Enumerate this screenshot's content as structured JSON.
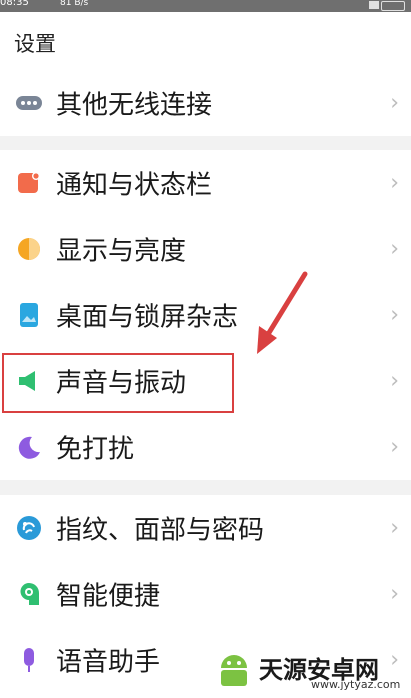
{
  "status_bar": {
    "time": "08:35",
    "speed": "81 B/s"
  },
  "header": {
    "title": "设置"
  },
  "groups": [
    {
      "items": [
        {
          "label": "其他无线连接",
          "icon": "dots-icon"
        }
      ]
    },
    {
      "items": [
        {
          "label": "通知与状态栏",
          "icon": "notification-icon"
        },
        {
          "label": "显示与亮度",
          "icon": "brightness-icon"
        },
        {
          "label": "桌面与锁屏杂志",
          "icon": "wallpaper-icon"
        },
        {
          "label": "声音与振动",
          "icon": "speaker-icon"
        },
        {
          "label": "免打扰",
          "icon": "moon-icon"
        }
      ]
    },
    {
      "items": [
        {
          "label": "指纹、面部与密码",
          "icon": "fingerprint-icon"
        },
        {
          "label": "智能便捷",
          "icon": "smart-icon"
        },
        {
          "label": "语音助手",
          "icon": "mic-icon"
        }
      ]
    }
  ],
  "chevron": "›",
  "colors": {
    "highlight_box": "#d94040",
    "arrow": "#d94040",
    "notification_icon": "#f26b4b",
    "brightness_icon": "#f5a623",
    "wallpaper_icon": "#2aa7e0",
    "speaker_icon": "#2fbf71",
    "moon_icon": "#8e5be0",
    "fingerprint_icon": "#2a9ad8",
    "smart_icon": "#2fbf71",
    "mic_icon": "#8e5be0"
  },
  "watermark": {
    "name": "天源安卓网",
    "url": "www.jytyaz.com"
  }
}
